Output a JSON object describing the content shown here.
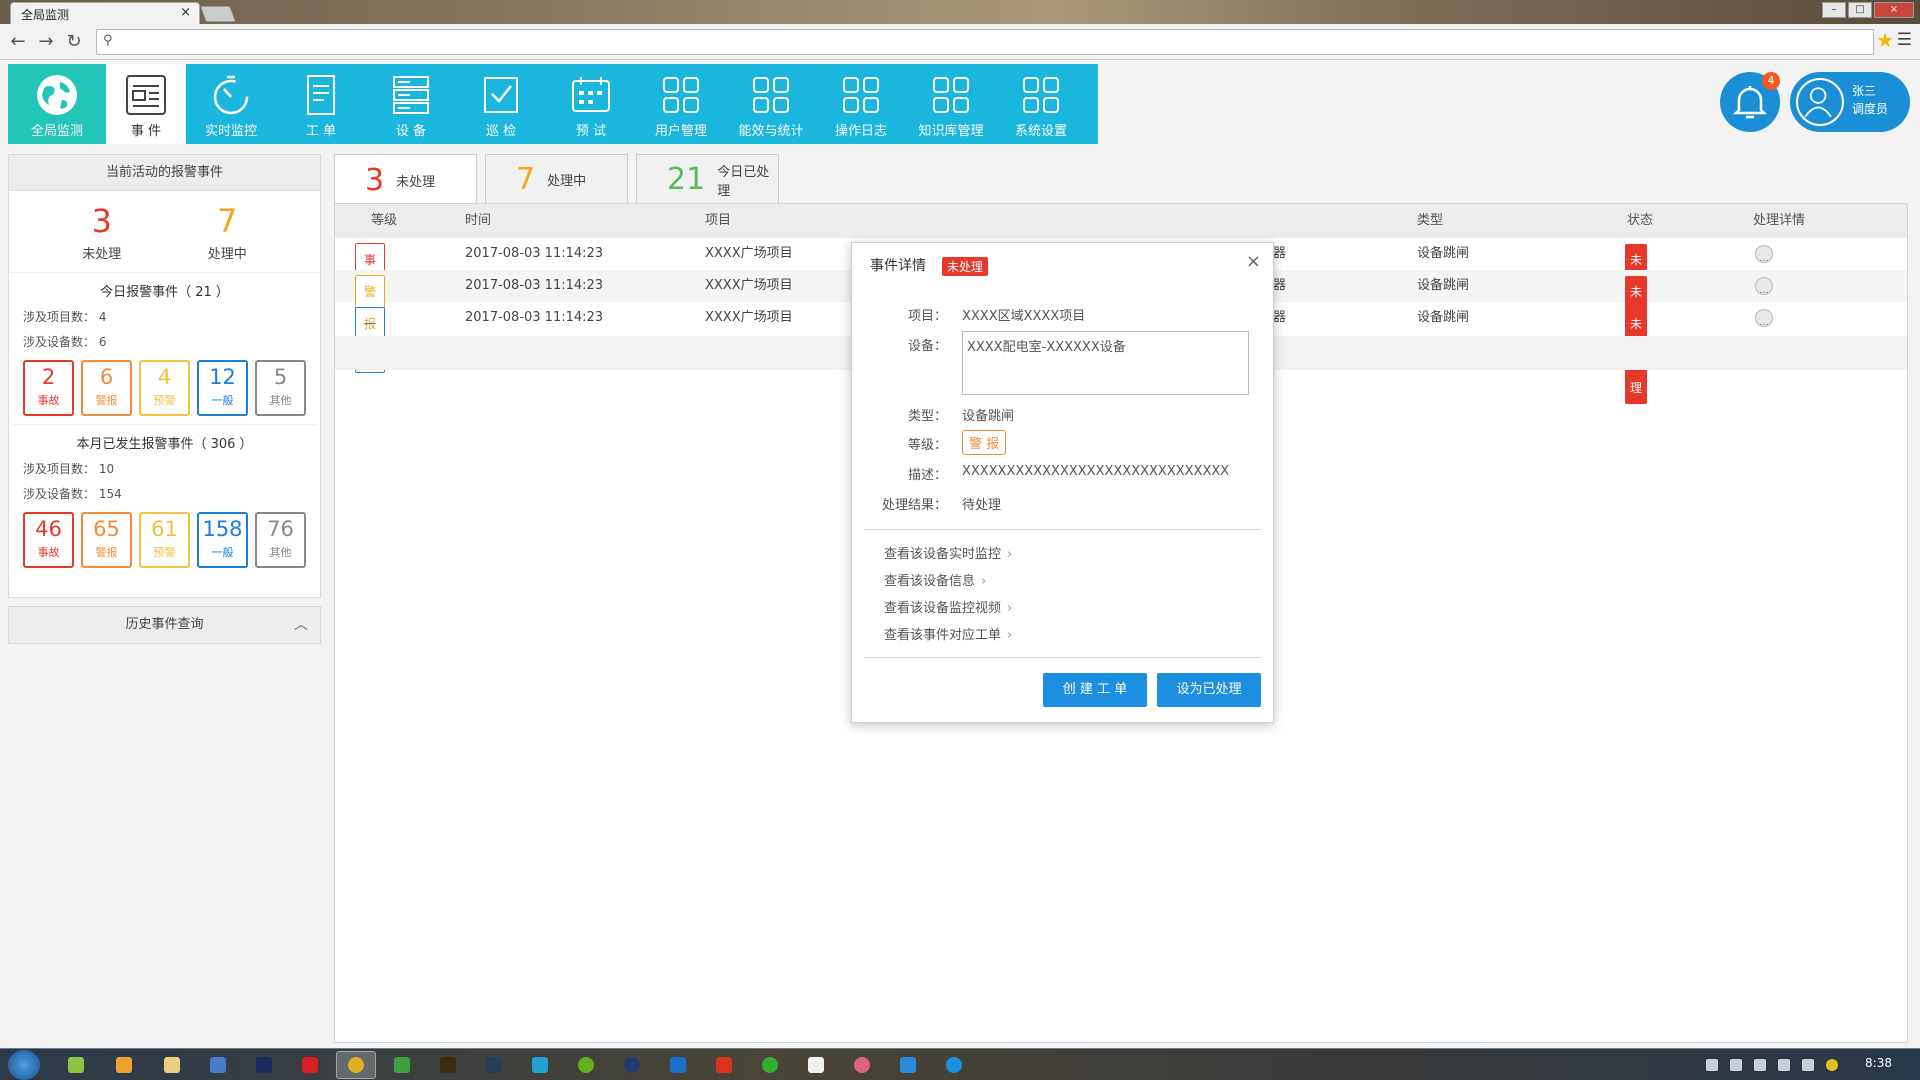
{
  "browser": {
    "tab_title": "全局监测",
    "tab_close": "×",
    "win_min": "–",
    "win_max": "□",
    "win_close": "×"
  },
  "nav": {
    "items": [
      {
        "label": "全局监测",
        "icon": "globe-icon"
      },
      {
        "label": "事 件",
        "icon": "event-list-icon"
      },
      {
        "label": "实时监控",
        "icon": "stopwatch-icon"
      },
      {
        "label": "工 单",
        "icon": "work-order-icon"
      },
      {
        "label": "设 备",
        "icon": "server-icon"
      },
      {
        "label": "巡 检",
        "icon": "checklist-icon"
      },
      {
        "label": "预 试",
        "icon": "calendar-icon"
      },
      {
        "label": "用户管理",
        "icon": "grid-icon"
      },
      {
        "label": "能效与统计",
        "icon": "grid-icon"
      },
      {
        "label": "操作日志",
        "icon": "grid-icon"
      },
      {
        "label": "知识库管理",
        "icon": "grid-icon"
      },
      {
        "label": "系统设置",
        "icon": "grid-icon"
      }
    ],
    "active": "事 件"
  },
  "header": {
    "notification_count": "4",
    "user_name": "张三",
    "user_role": "调度员"
  },
  "left_panel": {
    "title": "当前活动的报警事件",
    "unprocessed_count": "3",
    "unprocessed_label": "未处理",
    "processing_count": "7",
    "processing_label": "处理中",
    "today": {
      "title": "今日报警事件（ 21 ）",
      "projects": "涉及项目数： 4",
      "devices": "涉及设备数： 6",
      "boxes": [
        {
          "n": "2",
          "t": "事故"
        },
        {
          "n": "6",
          "t": "警报"
        },
        {
          "n": "4",
          "t": "预警"
        },
        {
          "n": "12",
          "t": "一般"
        },
        {
          "n": "5",
          "t": "其他"
        }
      ]
    },
    "month": {
      "title": "本月已发生报警事件（ 306 ）",
      "projects": "涉及项目数： 10",
      "devices": "涉及设备数： 154",
      "boxes": [
        {
          "n": "46",
          "t": "事故"
        },
        {
          "n": "65",
          "t": "警报"
        },
        {
          "n": "61",
          "t": "预警"
        },
        {
          "n": "158",
          "t": "一般"
        },
        {
          "n": "76",
          "t": "其他"
        }
      ]
    },
    "history_label": "历史事件查询"
  },
  "tabs": [
    {
      "n": "3",
      "t": "未处理",
      "color": "#e8382b"
    },
    {
      "n": "7",
      "t": "处理中",
      "color": "#f5a623"
    },
    {
      "n": "21",
      "t": "今日已处理",
      "color": "#5cb85c"
    }
  ],
  "table": {
    "headers": {
      "level": "等级",
      "time": "时间",
      "project": "项目",
      "device_tail": "",
      "type": "类型",
      "status": "状态",
      "detail": "处理详情"
    },
    "rows": [
      {
        "level": "事 故",
        "time": "2017-08-03 11:14:23",
        "project": "XXXX广场项目",
        "device_tail": "器",
        "type": "设备跳闸",
        "status": "未处理",
        "detail": "···"
      },
      {
        "level": "警 报",
        "time": "2017-08-03 11:14:23",
        "project": "XXXX广场项目",
        "device_tail": "器",
        "type": "设备跳闸",
        "status": "未处理",
        "detail": "···"
      },
      {
        "level": "一 般",
        "time": "2017-08-03 11:14:23",
        "project": "XXXX广场项目",
        "device_tail": "器",
        "type": "设备跳闸",
        "status": "未处理",
        "detail": "···"
      }
    ]
  },
  "modal": {
    "title": "事件详情",
    "status_tag": "未处理",
    "close": "×",
    "project_label": "项目：",
    "project_value": "XXXX区域XXXX项目",
    "device_label": "设备：",
    "device_value": "XXXX配电室-XXXXXX设备",
    "type_label": "类型：",
    "type_value": "设备跳闸",
    "level_label": "等级：",
    "level_value": "警 报",
    "desc_label": "描述：",
    "desc_value": "XXXXXXXXXXXXXXXXXXXXXXXXXXXXXX",
    "result_label": "处理结果：",
    "result_value": "待处理",
    "links": [
      "查看该设备实时监控",
      "查看该设备信息",
      "查看该设备监控视频",
      "查看该事件对应工单"
    ],
    "btn_create": "创 建 工 单",
    "btn_done": "设为已处理"
  },
  "taskbar": {
    "clock": "8:38"
  },
  "colors": {
    "accident": "#e8382b",
    "alarm": "#f18b3a",
    "warning": "#f5c040",
    "normal": "#1c7ed6",
    "other": "#888888",
    "nav_bg": "#1ab6de",
    "primary": "#1c8fe0"
  }
}
